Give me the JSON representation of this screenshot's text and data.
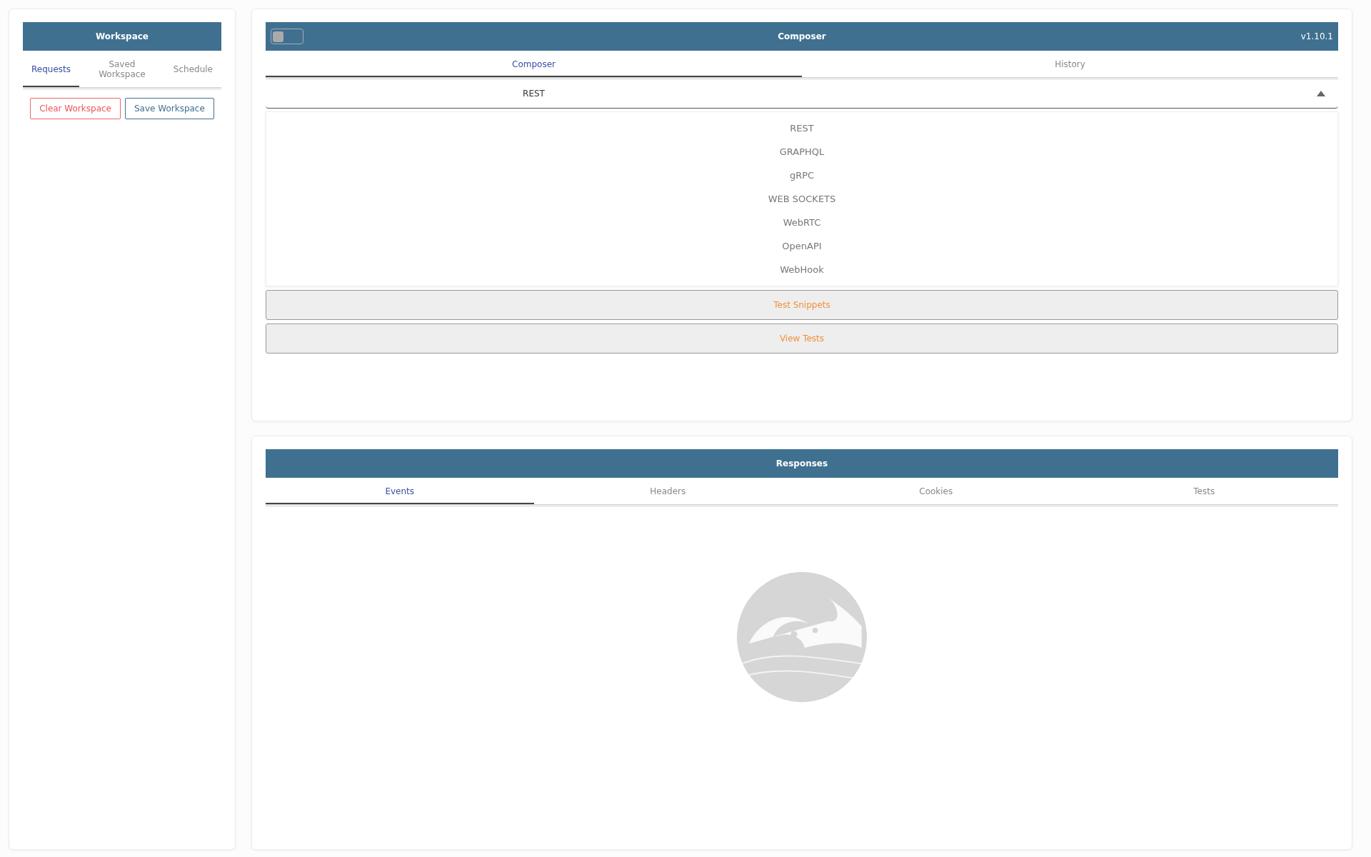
{
  "sidebar": {
    "title": "Workspace",
    "tabs": [
      {
        "label": "Requests",
        "selected": true
      },
      {
        "label": "Saved Workspace",
        "selected": false
      },
      {
        "label": "Schedule",
        "selected": false
      }
    ],
    "buttons": [
      {
        "label": "Clear Workspace",
        "kind": "danger"
      },
      {
        "label": "Save Workspace",
        "kind": "primary"
      }
    ]
  },
  "composer": {
    "title": "Composer",
    "version": "v1.10.1",
    "toggle": {
      "on": false
    },
    "tabs": [
      {
        "label": "Composer",
        "selected": true
      },
      {
        "label": "History",
        "selected": false
      }
    ],
    "protocol_select": {
      "value": "REST",
      "expanded": true,
      "options": [
        "REST",
        "GRAPHQL",
        "gRPC",
        "WEB SOCKETS",
        "WebRTC",
        "OpenAPI",
        "WebHook"
      ]
    },
    "buttons": [
      "Test Snippets",
      "View Tests"
    ]
  },
  "responses": {
    "title": "Responses",
    "tabs": [
      {
        "label": "Events",
        "selected": true
      },
      {
        "label": "Headers",
        "selected": false
      },
      {
        "label": "Cookies",
        "selected": false
      },
      {
        "label": "Tests",
        "selected": false
      }
    ]
  }
}
